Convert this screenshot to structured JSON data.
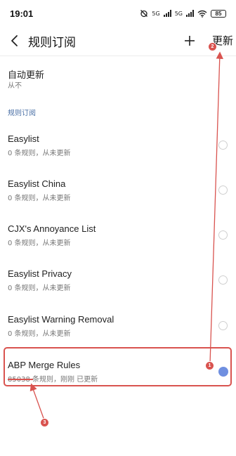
{
  "status_bar": {
    "time": "19:01",
    "signal1": "5G",
    "signal2": "5G",
    "battery": "85"
  },
  "header": {
    "title": "规则订阅",
    "add_icon": "plus-icon",
    "update_label": "更新"
  },
  "auto_update": {
    "title": "自动更新",
    "value": "从不"
  },
  "section": {
    "title": "规则订阅"
  },
  "rules": [
    {
      "name": "Easylist",
      "status": "0 条规则，从未更新",
      "selected": false
    },
    {
      "name": "Easylist China",
      "status": "0 条规则，从未更新",
      "selected": false
    },
    {
      "name": "CJX's Annoyance List",
      "status": "0 条规则，从未更新",
      "selected": false
    },
    {
      "name": "Easylist Privacy",
      "status": "0 条规则，从未更新",
      "selected": false
    },
    {
      "name": "Easylist Warning Removal",
      "status": "0 条规则，从未更新",
      "selected": false
    },
    {
      "name": "ABP Merge Rules",
      "status": "85038 条规则，刚刚 已更新",
      "selected": true
    }
  ],
  "annotations": {
    "badge1": "1",
    "badge2": "2",
    "badge3": "3",
    "color": "#d9534f"
  },
  "accent_color": "#6f8fe0"
}
